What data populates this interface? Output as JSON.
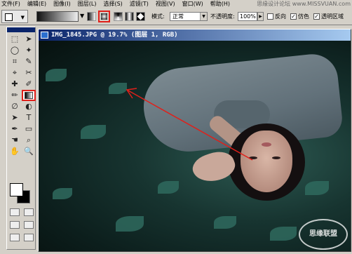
{
  "menubar": {
    "items": [
      "文件(F)",
      "编辑(E)",
      "图像(I)",
      "图层(L)",
      "选择(S)",
      "滤镜(T)",
      "视图(V)",
      "窗口(W)",
      "帮助(H)"
    ]
  },
  "site_watermark_top": "思缘设计论坛 www.MISSVUAN.com",
  "options": {
    "mode_label": "模式:",
    "mode_value": "正常",
    "opacity_label": "不透明度:",
    "opacity_value": "100%",
    "reverse_label": "反向",
    "dither_label": "仿色",
    "transparency_label": "透明区域",
    "reverse_checked": false,
    "dither_checked": true,
    "transparency_checked": true
  },
  "document": {
    "title": "IMG_1845.JPG @ 19.7% (图层 1, RGB)"
  },
  "toolbox": {
    "tools": [
      "⬚",
      "➤",
      "◯",
      "✦",
      "⌗",
      "✎",
      "⌖",
      "✂",
      "✚",
      "✐",
      "✏",
      "▣",
      "∅",
      "◐",
      "➤",
      "T",
      "✒",
      "▭",
      "☚",
      "⌕",
      "✋",
      "🔍"
    ]
  },
  "colors": {
    "foreground": "#ffffff",
    "background": "#000000",
    "highlight": "#e0201a"
  },
  "logo_text": "思缘联盟"
}
